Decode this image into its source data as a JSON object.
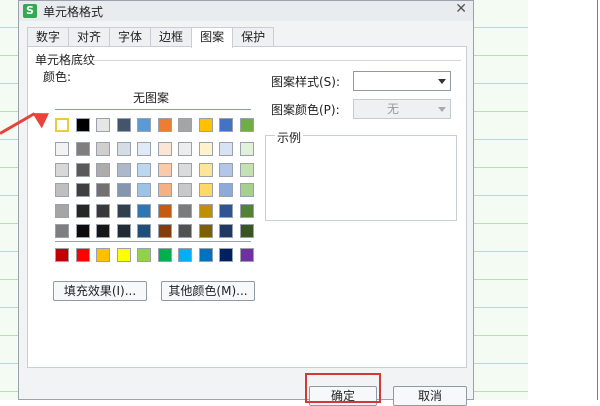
{
  "window": {
    "title": "单元格格式",
    "icon_letter": "S"
  },
  "tabs": [
    {
      "label": "数字"
    },
    {
      "label": "对齐"
    },
    {
      "label": "字体"
    },
    {
      "label": "边框"
    },
    {
      "label": "图案"
    },
    {
      "label": "保护"
    }
  ],
  "active_tab": "图案",
  "shading": {
    "group_title": "单元格底纹",
    "color_label": "颜色:",
    "no_pattern_label": "无图案",
    "fill_effects_button": "填充效果(I)...",
    "more_colors_button": "其他颜色(M)...",
    "selected_color": "#ffffff"
  },
  "palette": {
    "row1": [
      "#ffffff",
      "#000000",
      "#e7e6e6",
      "#44546a",
      "#5b9bd5",
      "#ed7d31",
      "#a5a5a5",
      "#ffc000",
      "#4472c4",
      "#70ad47"
    ],
    "theme_rows": [
      [
        "#f2f2f2",
        "#7f7f7f",
        "#d0cece",
        "#d6dce4",
        "#deebf6",
        "#fbe5d5",
        "#ededed",
        "#fff2cc",
        "#d9e2f3",
        "#e2efd9"
      ],
      [
        "#d8d8d8",
        "#595959",
        "#aeabab",
        "#adb9ca",
        "#bdd7ee",
        "#f7cbac",
        "#dbdbdb",
        "#fee599",
        "#b4c6e7",
        "#c5e0b3"
      ],
      [
        "#bfbfbf",
        "#3f3f3f",
        "#757070",
        "#8496b0",
        "#9cc3e5",
        "#f4b183",
        "#c9c9c9",
        "#ffd965",
        "#8eaadb",
        "#a8d08d"
      ],
      [
        "#a5a5a5",
        "#262626",
        "#3a3838",
        "#323f4f",
        "#2e75b5",
        "#c55a11",
        "#7b7b7b",
        "#bf9000",
        "#2f5496",
        "#538135"
      ],
      [
        "#7f7f7f",
        "#0c0c0c",
        "#171616",
        "#222a35",
        "#1e4e79",
        "#833c0b",
        "#525252",
        "#7f6000",
        "#1f3864",
        "#375623"
      ]
    ],
    "standard": [
      "#c00000",
      "#ff0000",
      "#ffc000",
      "#ffff00",
      "#92d050",
      "#00b050",
      "#00b0f0",
      "#0070c0",
      "#002060",
      "#7030a0"
    ]
  },
  "pattern": {
    "style_label": "图案样式(S):",
    "color_label": "图案颜色(P):",
    "color_value": "无",
    "sample_label": "示例"
  },
  "footer": {
    "ok_label": "确定",
    "cancel_label": "取消"
  },
  "annotation_color": "#e8423a",
  "highlight_color": "#d23a3a"
}
